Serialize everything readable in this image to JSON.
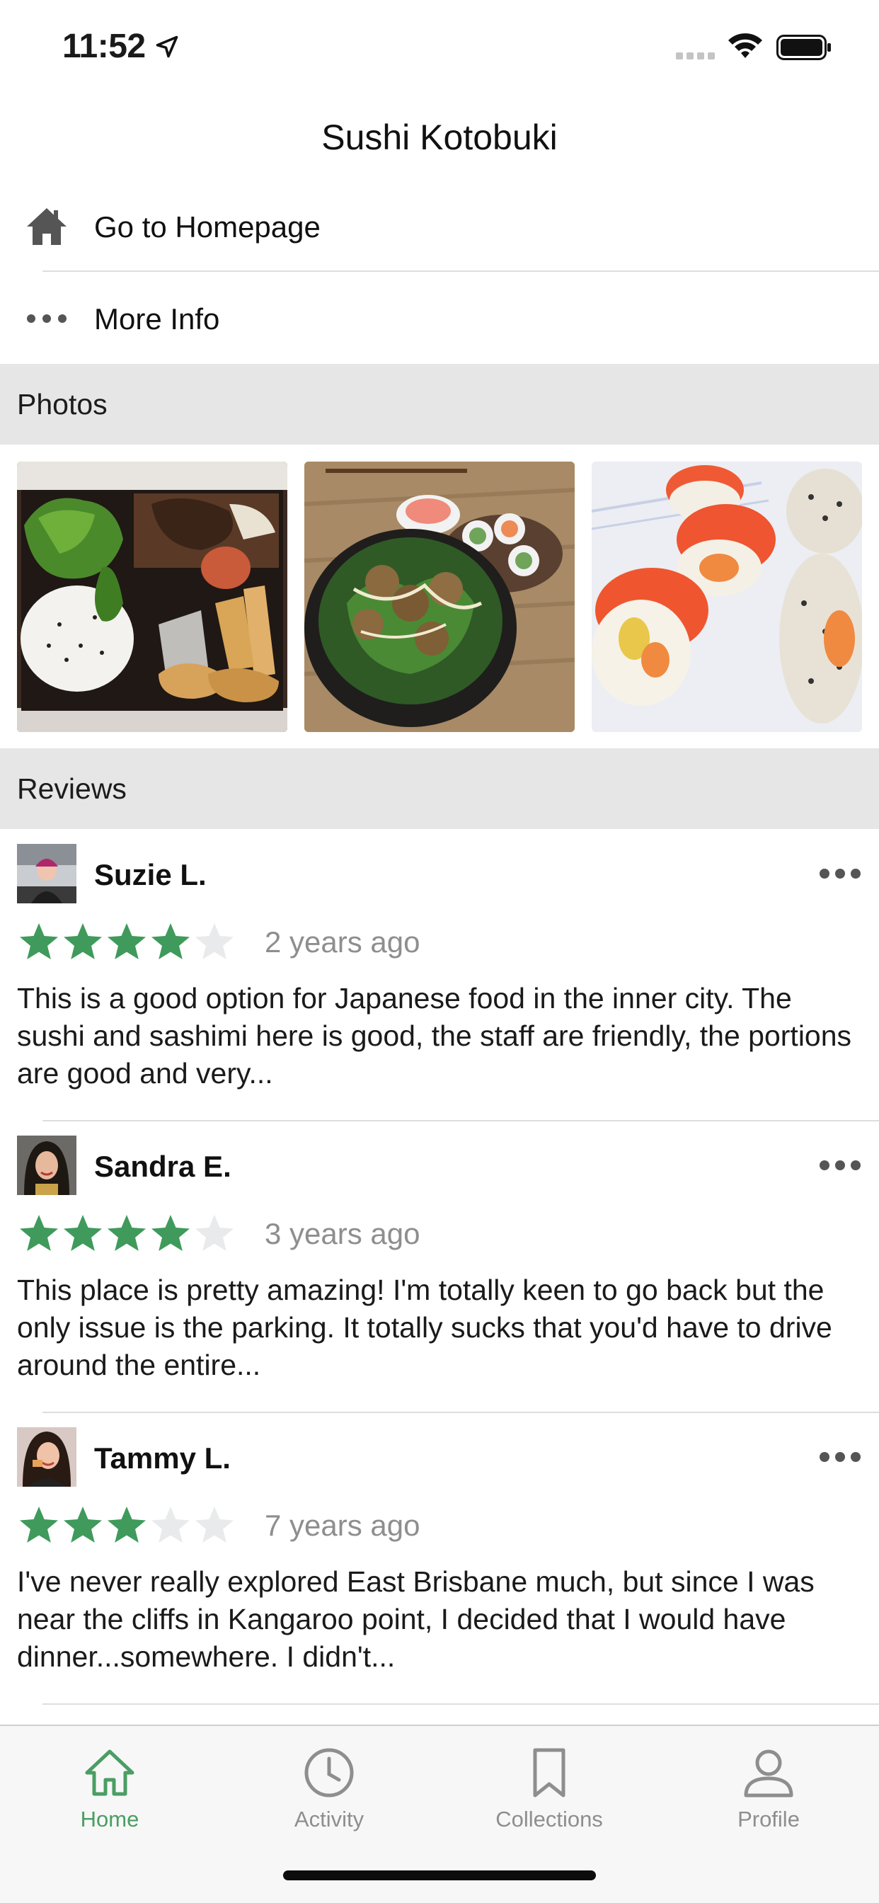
{
  "status_bar": {
    "time": "11:52"
  },
  "header": {
    "title": "Sushi Kotobuki"
  },
  "actions": [
    {
      "label": "Go to Homepage",
      "icon": "house-icon"
    },
    {
      "label": "More Info",
      "icon": "more-horizontal-icon"
    }
  ],
  "sections": {
    "photos": "Photos",
    "reviews": "Reviews"
  },
  "photos": [
    {
      "icon": "bento-box-photo"
    },
    {
      "icon": "salad-bowl-photo"
    },
    {
      "icon": "sushi-rolls-photo"
    }
  ],
  "reviews": [
    {
      "name": "Suzie L.",
      "rating": 4,
      "max_rating": 5,
      "time": "2 years ago",
      "text": "This is a good option for Japanese food in the inner city. The sushi and sashimi here is good, the staff are friendly, the portions are good and very..."
    },
    {
      "name": "Sandra E.",
      "rating": 4,
      "max_rating": 5,
      "time": "3 years ago",
      "text": "This place is pretty amazing! I'm totally keen to go back but the only issue is the parking. It totally sucks that you'd have to drive around the entire..."
    },
    {
      "name": "Tammy L.",
      "rating": 3,
      "max_rating": 5,
      "time": "7 years ago",
      "text": "I've never really explored East Brisbane much, but since I was near the cliffs in Kangaroo point, I decided that I would have dinner...somewhere.  I didn't..."
    }
  ],
  "tabs": [
    {
      "label": "Home",
      "icon": "home-icon",
      "active": true
    },
    {
      "label": "Activity",
      "icon": "clock-icon",
      "active": false
    },
    {
      "label": "Collections",
      "icon": "bookmark-icon",
      "active": false
    },
    {
      "label": "Profile",
      "icon": "person-icon",
      "active": false
    }
  ],
  "colors": {
    "accent": "#4a9e63",
    "star_filled": "#3f9a5c",
    "star_empty": "#e8eaeb",
    "section_bg": "#e6e6e6"
  }
}
